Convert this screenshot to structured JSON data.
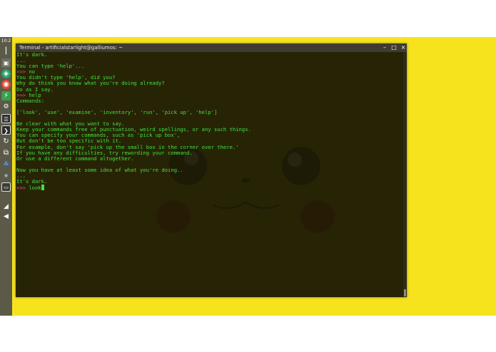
{
  "shelf": {
    "clock": "10:2",
    "icons": [
      "app-launcher-icon",
      "drag-handle-icon",
      "chrome-icon",
      "files-icon",
      "settings-icon",
      "maps-icon",
      "terminal-icon",
      "editor-icon",
      "media-icon",
      "network-icon",
      "python-icon",
      "window-icon",
      "wifi-icon",
      "volume-icon"
    ]
  },
  "window": {
    "title": "Terminal - artificialstarlight@galliumos: ~",
    "minimize_glyph": "–",
    "maximize_glyph": "□",
    "close_glyph": "×"
  },
  "terminal": {
    "lines": [
      {
        "prompt": "",
        "text": "It's dark."
      },
      {
        "prompt": "",
        "text": "..."
      },
      {
        "prompt": "",
        "text": "You can type 'help'..."
      },
      {
        "prompt": ">>> ",
        "text": "no"
      },
      {
        "prompt": "",
        "text": "You didn't type 'help', did you?"
      },
      {
        "prompt": "",
        "text": "Why do think you know what you're doing already?"
      },
      {
        "prompt": "",
        "text": "Do as I say."
      },
      {
        "prompt": ">>> ",
        "text": "help"
      },
      {
        "prompt": "",
        "text": "Commands:"
      },
      {
        "prompt": "",
        "text": ""
      },
      {
        "prompt": "",
        "text": "['look', 'use', 'examine', 'inventory', 'run', 'pick up', 'help']"
      },
      {
        "prompt": "",
        "text": ""
      },
      {
        "prompt": "",
        "text": "Be clear with what you want to say."
      },
      {
        "prompt": "",
        "text": "Keep your commands free of punctuation, weird spellings, or any such things."
      },
      {
        "prompt": "",
        "text": "You can specify your commands, such as 'pick up box',"
      },
      {
        "prompt": "",
        "text": "But don't be too specific with it."
      },
      {
        "prompt": "",
        "text": "For example, don't say 'pick up the small box in the corner over there.'"
      },
      {
        "prompt": "",
        "text": "If you have any difficulties, try rewording your command."
      },
      {
        "prompt": "",
        "text": "Or use a different command altogether."
      },
      {
        "prompt": "",
        "text": ""
      },
      {
        "prompt": "",
        "text": "Now you have at least some idea of what you're doing.."
      },
      {
        "prompt": "",
        "text": "..."
      },
      {
        "prompt": "",
        "text": "It's dark."
      },
      {
        "prompt": ">>> ",
        "text": "look",
        "cursor": true
      }
    ]
  },
  "colors": {
    "desktop": "#f7e31d",
    "terminal_text": "#3fe33f",
    "prompt": "#f04f8f",
    "terminal_bg": "#1e1c05"
  }
}
